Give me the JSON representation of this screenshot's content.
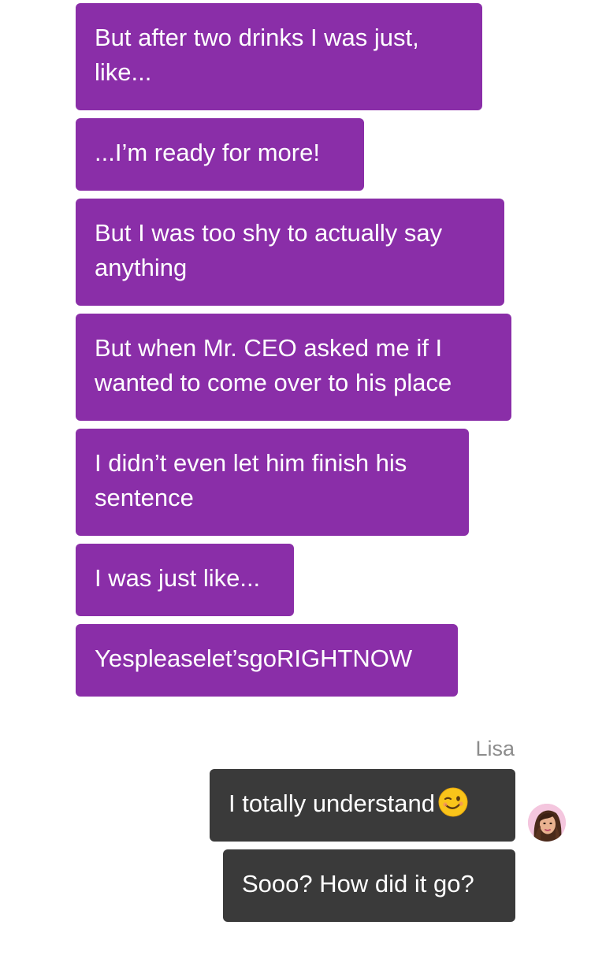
{
  "messages_outgoing": [
    {
      "text": "But after two drinks I was just, like..."
    },
    {
      "text": "...I’m ready for more!"
    },
    {
      "text": "But I was too shy to actually say anything"
    },
    {
      "text": "But when Mr. CEO asked me if I wanted to come over to his place"
    },
    {
      "text": "I didn’t even let him finish his sentence"
    },
    {
      "text": "I was just like..."
    },
    {
      "text": "Yespleaselet’sgoRIGHTNOW"
    }
  ],
  "contact": {
    "name": "Lisa",
    "avatar_icon": "lisa-avatar-icon"
  },
  "messages_incoming": [
    {
      "text": "I totally understand",
      "emoji": "winking-face-emoji"
    },
    {
      "text": "Sooo? How did it go?"
    }
  ],
  "colors": {
    "outgoing_bubble": "#8a2ea8",
    "incoming_bubble": "#3a3a3a",
    "sender_label": "#8c8c8c",
    "background": "#ffffff"
  }
}
